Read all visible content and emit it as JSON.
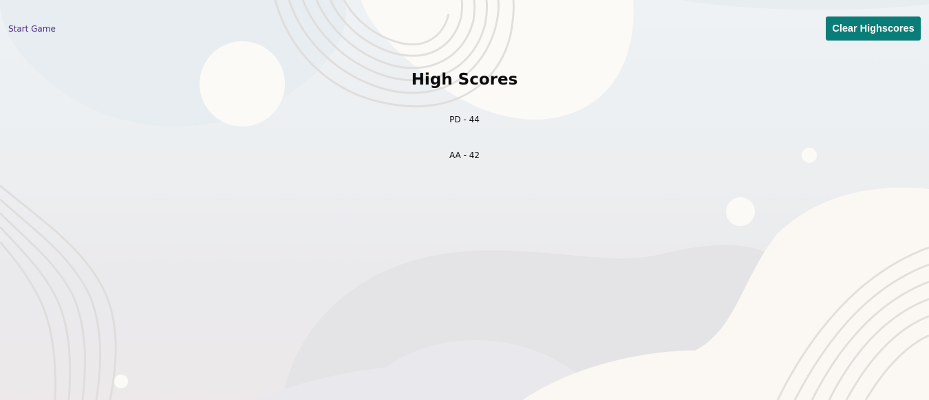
{
  "nav": {
    "start_game_label": "Start Game"
  },
  "toolbar": {
    "clear_label": "Clear Highscores"
  },
  "page": {
    "title": "High Scores"
  },
  "scores": [
    {
      "text": "PD - 44"
    },
    {
      "text": "AA - 42"
    }
  ],
  "colors": {
    "accent_button": "#0b7d78",
    "link": "#4a2f86",
    "background": "#eceef0"
  }
}
